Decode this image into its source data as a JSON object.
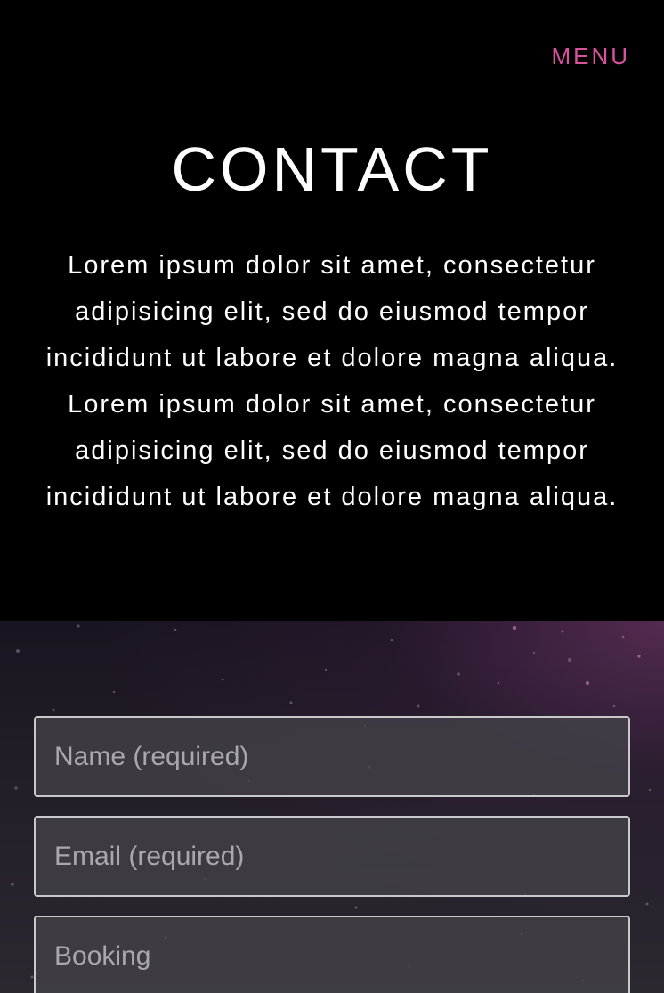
{
  "header": {
    "menu_label": "MENU",
    "menu_color": "#d9529f"
  },
  "main": {
    "title": "CONTACT",
    "intro_text": "Lorem ipsum dolor sit amet, consectetur adipisicing elit, sed do eiusmod tempor incididunt ut labore et dolore magna aliqua. Lorem ipsum dolor sit amet, consectetur adipisicing elit, sed do eiusmod tempor incididunt ut labore et dolore magna aliqua."
  },
  "form": {
    "name_placeholder": "Name (required)",
    "name_value": "",
    "email_placeholder": "Email (required)",
    "email_value": "",
    "booking_placeholder": "Booking",
    "booking_value": ""
  }
}
